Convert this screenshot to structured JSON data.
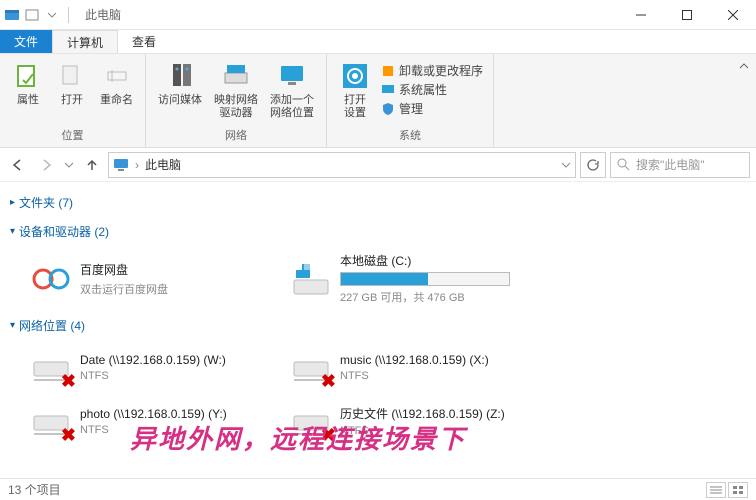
{
  "window": {
    "title": "此电脑"
  },
  "tabs": {
    "file": "文件",
    "computer": "计算机",
    "view": "查看"
  },
  "ribbon": {
    "groups": [
      {
        "name": "位置",
        "items": [
          {
            "label": "属性"
          },
          {
            "label": "打开"
          },
          {
            "label": "重命名"
          }
        ]
      },
      {
        "name": "网络",
        "items": [
          {
            "label": "访问媒体"
          },
          {
            "label": "映射网络\n驱动器"
          },
          {
            "label": "添加一个\n网络位置"
          }
        ]
      },
      {
        "name": "系统",
        "items": [
          {
            "label": "打开\n设置"
          }
        ],
        "list": [
          "卸载或更改程序",
          "系统属性",
          "管理"
        ]
      }
    ]
  },
  "breadcrumb": {
    "root": "此电脑"
  },
  "search": {
    "placeholder": "搜索\"此电脑\""
  },
  "sections": {
    "folders": {
      "label": "文件夹 (7)"
    },
    "devices": {
      "label": "设备和驱动器 (2)",
      "items": [
        {
          "name": "百度网盘",
          "sub": "双击运行百度网盘",
          "kind": "baidu"
        },
        {
          "name": "本地磁盘 (C:)",
          "sub": "227 GB 可用，共 476 GB",
          "kind": "disk",
          "fill": 52
        }
      ]
    },
    "network": {
      "label": "网络位置 (4)",
      "items": [
        {
          "name": "Date (\\\\192.168.0.159) (W:)",
          "sub": "NTFS"
        },
        {
          "name": "music (\\\\192.168.0.159) (X:)",
          "sub": "NTFS"
        },
        {
          "name": "photo (\\\\192.168.0.159) (Y:)",
          "sub": "NTFS"
        },
        {
          "name": "历史文件 (\\\\192.168.0.159) (Z:)",
          "sub": "NTFS"
        }
      ]
    }
  },
  "caption": "异地外网，远程连接场景下",
  "status": {
    "count": "13 个项目"
  }
}
